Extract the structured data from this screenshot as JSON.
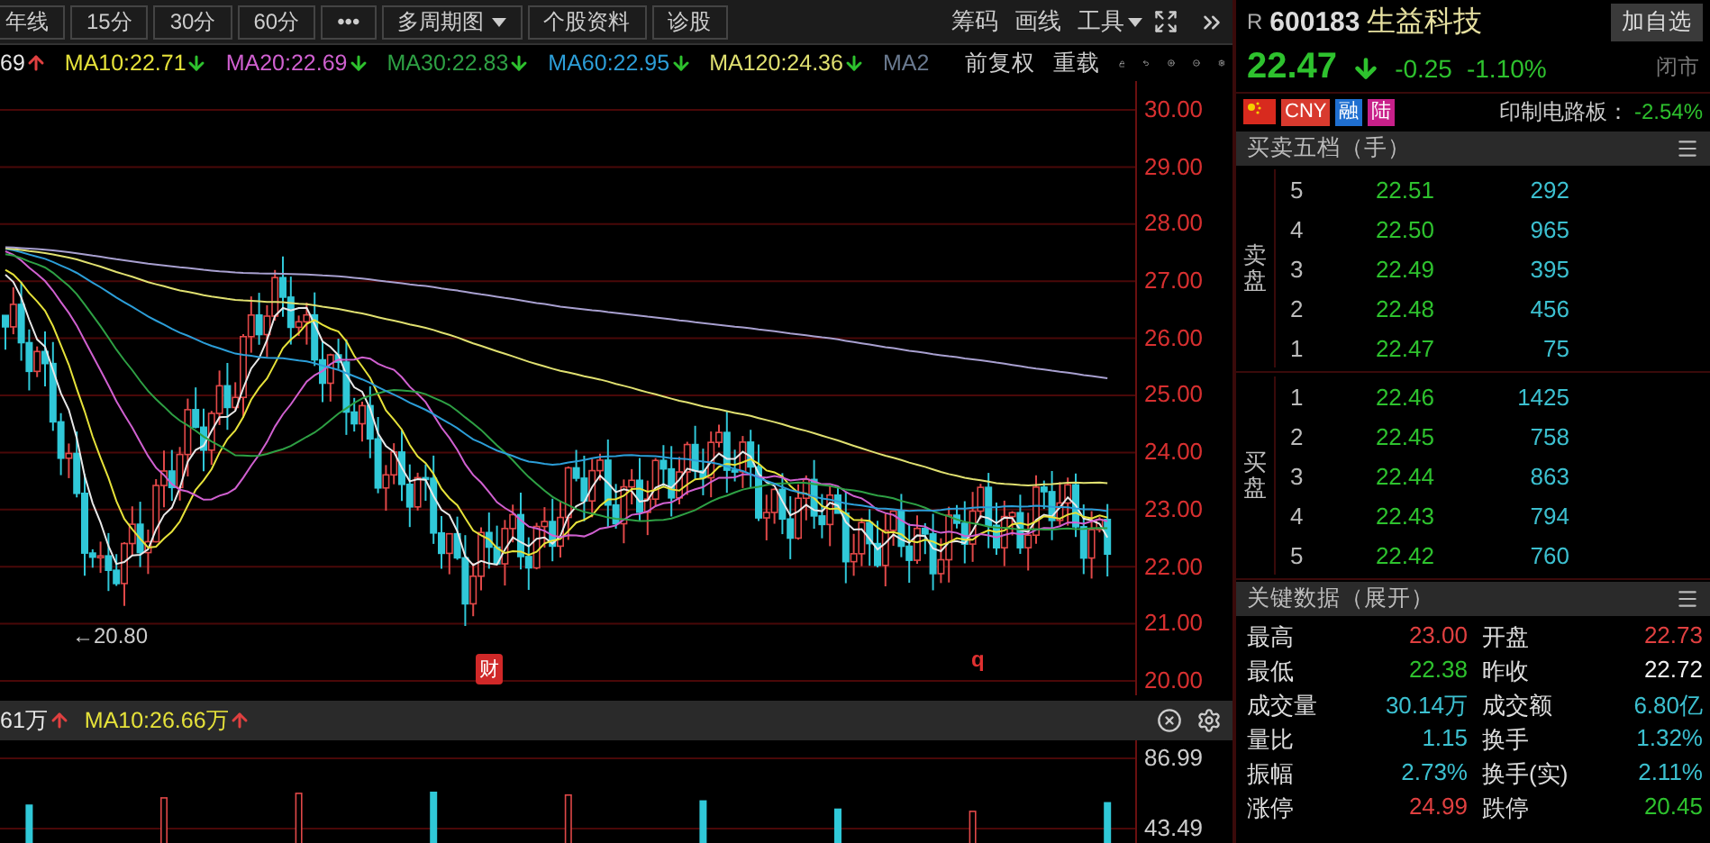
{
  "toolbar": {
    "period_buttons": [
      {
        "label": "年线",
        "dropdown": false
      },
      {
        "label": "15分",
        "dropdown": false
      },
      {
        "label": "30分",
        "dropdown": false
      },
      {
        "label": "60分",
        "dropdown": false
      },
      {
        "label": "•••",
        "dropdown": false
      },
      {
        "label": "多周期图",
        "dropdown": true
      },
      {
        "label": "个股资料",
        "dropdown": false
      },
      {
        "label": "诊股",
        "dropdown": false
      }
    ],
    "tools": [
      {
        "label": "筹码",
        "dropdown": false
      },
      {
        "label": "画线",
        "dropdown": false
      },
      {
        "label": "工具",
        "dropdown": true
      }
    ]
  },
  "ma_legend": [
    {
      "label": "69",
      "color": "#e8e8e8",
      "rising": true
    },
    {
      "label": "MA10:22.71",
      "color": "#e6e23a",
      "rising": false
    },
    {
      "label": "MA20:22.69",
      "color": "#d060d0",
      "rising": false
    },
    {
      "label": "MA30:22.83",
      "color": "#2ea044",
      "rising": false
    },
    {
      "label": "MA60:22.95",
      "color": "#2c9ed8",
      "rising": false
    },
    {
      "label": "MA120:24.36",
      "color": "#e0e070",
      "rising": false
    },
    {
      "label": "MA2",
      "color": "#6a7a90"
    }
  ],
  "chart_options": [
    "前复权",
    "重载"
  ],
  "price_axis": [
    "30.00",
    "29.00",
    "28.00",
    "27.00",
    "26.00",
    "25.00",
    "24.00",
    "23.00",
    "22.00",
    "21.00",
    "20.00"
  ],
  "annotations": {
    "low_marker": "←20.80",
    "event_badge": "财",
    "marker": "q"
  },
  "volume": {
    "legend": [
      {
        "label": "61万",
        "color": "#e8e8e8",
        "rising": true
      },
      {
        "label": "MA10:26.66万",
        "color": "#e6e23a",
        "rising": true
      }
    ],
    "axis": [
      "86.99",
      "43.49"
    ]
  },
  "quote": {
    "market": "R",
    "code": "600183",
    "name": "生益科技",
    "watch_button": "加自选",
    "price": "22.47",
    "rising": false,
    "change": "-0.25",
    "change_pct": "-1.10%",
    "status": "闭市"
  },
  "tags": [
    {
      "label": "CNY",
      "color": "#d83a2e"
    },
    {
      "label": "融",
      "color": "#1f6fd0"
    },
    {
      "label": "陆",
      "color": "#c8208a"
    }
  ],
  "sector": {
    "name": "印制电路板：",
    "change": "-2.54%"
  },
  "order_book": {
    "title": "买卖五档（手）",
    "sides": [
      {
        "label": "卖盘",
        "rows": [
          {
            "level": "5",
            "price": "22.51",
            "volume": "292"
          },
          {
            "level": "4",
            "price": "22.50",
            "volume": "965"
          },
          {
            "level": "3",
            "price": "22.49",
            "volume": "395"
          },
          {
            "level": "2",
            "price": "22.48",
            "volume": "456"
          },
          {
            "level": "1",
            "price": "22.47",
            "volume": "75"
          }
        ]
      },
      {
        "label": "买盘",
        "rows": [
          {
            "level": "1",
            "price": "22.46",
            "volume": "1425"
          },
          {
            "level": "2",
            "price": "22.45",
            "volume": "758"
          },
          {
            "level": "3",
            "price": "22.44",
            "volume": "863"
          },
          {
            "level": "4",
            "price": "22.43",
            "volume": "794"
          },
          {
            "level": "5",
            "price": "22.42",
            "volume": "760"
          }
        ]
      }
    ]
  },
  "key_data": {
    "title": "关键数据（展开）",
    "rows": [
      [
        {
          "label": "最高",
          "value": "23.00",
          "color": "#e04040"
        },
        {
          "label": "开盘",
          "value": "22.73",
          "color": "#e04040"
        }
      ],
      [
        {
          "label": "最低",
          "value": "22.38",
          "color": "#2ec22e"
        },
        {
          "label": "昨收",
          "value": "22.72",
          "color": "#f0f0f0"
        }
      ],
      [
        {
          "label": "成交量",
          "value": "30.14万",
          "color": "#3cc0d0"
        },
        {
          "label": "成交额",
          "value": "6.80亿",
          "color": "#3cc0d0"
        }
      ],
      [
        {
          "label": "量比",
          "value": "1.15",
          "color": "#3cc0d0"
        },
        {
          "label": "换手",
          "value": "1.32%",
          "color": "#3cc0d0"
        }
      ],
      [
        {
          "label": "振幅",
          "value": "2.73%",
          "color": "#3cc0d0"
        },
        {
          "label": "换手(实)",
          "value": "2.11%",
          "color": "#3cc0d0"
        }
      ],
      [
        {
          "label": "涨停",
          "value": "24.99",
          "color": "#e04040"
        },
        {
          "label": "跌停",
          "value": "20.45",
          "color": "#2ec22e"
        }
      ]
    ]
  }
}
